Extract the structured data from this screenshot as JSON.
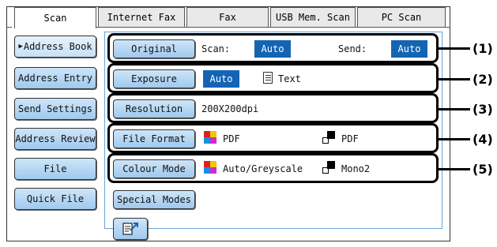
{
  "tabs": [
    {
      "label": "Scan",
      "active": true
    },
    {
      "label": "Internet Fax",
      "active": false
    },
    {
      "label": "Fax",
      "active": false
    },
    {
      "label": "USB Mem. Scan",
      "active": false
    },
    {
      "label": "PC Scan",
      "active": false
    }
  ],
  "sidebar": {
    "items": [
      {
        "label": "Address Book",
        "selected": true
      },
      {
        "label": "Address Entry"
      },
      {
        "label": "Send Settings"
      },
      {
        "label": "Address Review"
      },
      {
        "label": "File"
      },
      {
        "label": "Quick File"
      }
    ]
  },
  "settings": {
    "original": {
      "button": "Original",
      "scan_label": "Scan:",
      "scan_value": "Auto",
      "send_label": "Send:",
      "send_value": "Auto"
    },
    "exposure": {
      "button": "Exposure",
      "value": "Auto",
      "text_label": "Text"
    },
    "resolution": {
      "button": "Resolution",
      "value": "200X200dpi"
    },
    "file_format": {
      "button": "File Format",
      "colour_value": "PDF",
      "mono_value": "PDF"
    },
    "colour_mode": {
      "button": "Colour Mode",
      "colour_value": "Auto/Greyscale",
      "mono_value": "Mono2"
    },
    "special_modes": {
      "button": "Special Modes"
    }
  },
  "callouts": [
    "(1)",
    "(2)",
    "(3)",
    "(4)",
    "(5)"
  ],
  "colors": {
    "accent": "#1464b4",
    "button_top": "#cfe5f8",
    "button_bottom": "#9fc9ee",
    "panel_border": "#6aa3d8"
  },
  "icons": {
    "bottom_button": "edit-send-icon",
    "text_icon": "document-text-icon",
    "colour_icon": "colour-squares-icon",
    "mono_icon": "mono-squares-icon"
  }
}
